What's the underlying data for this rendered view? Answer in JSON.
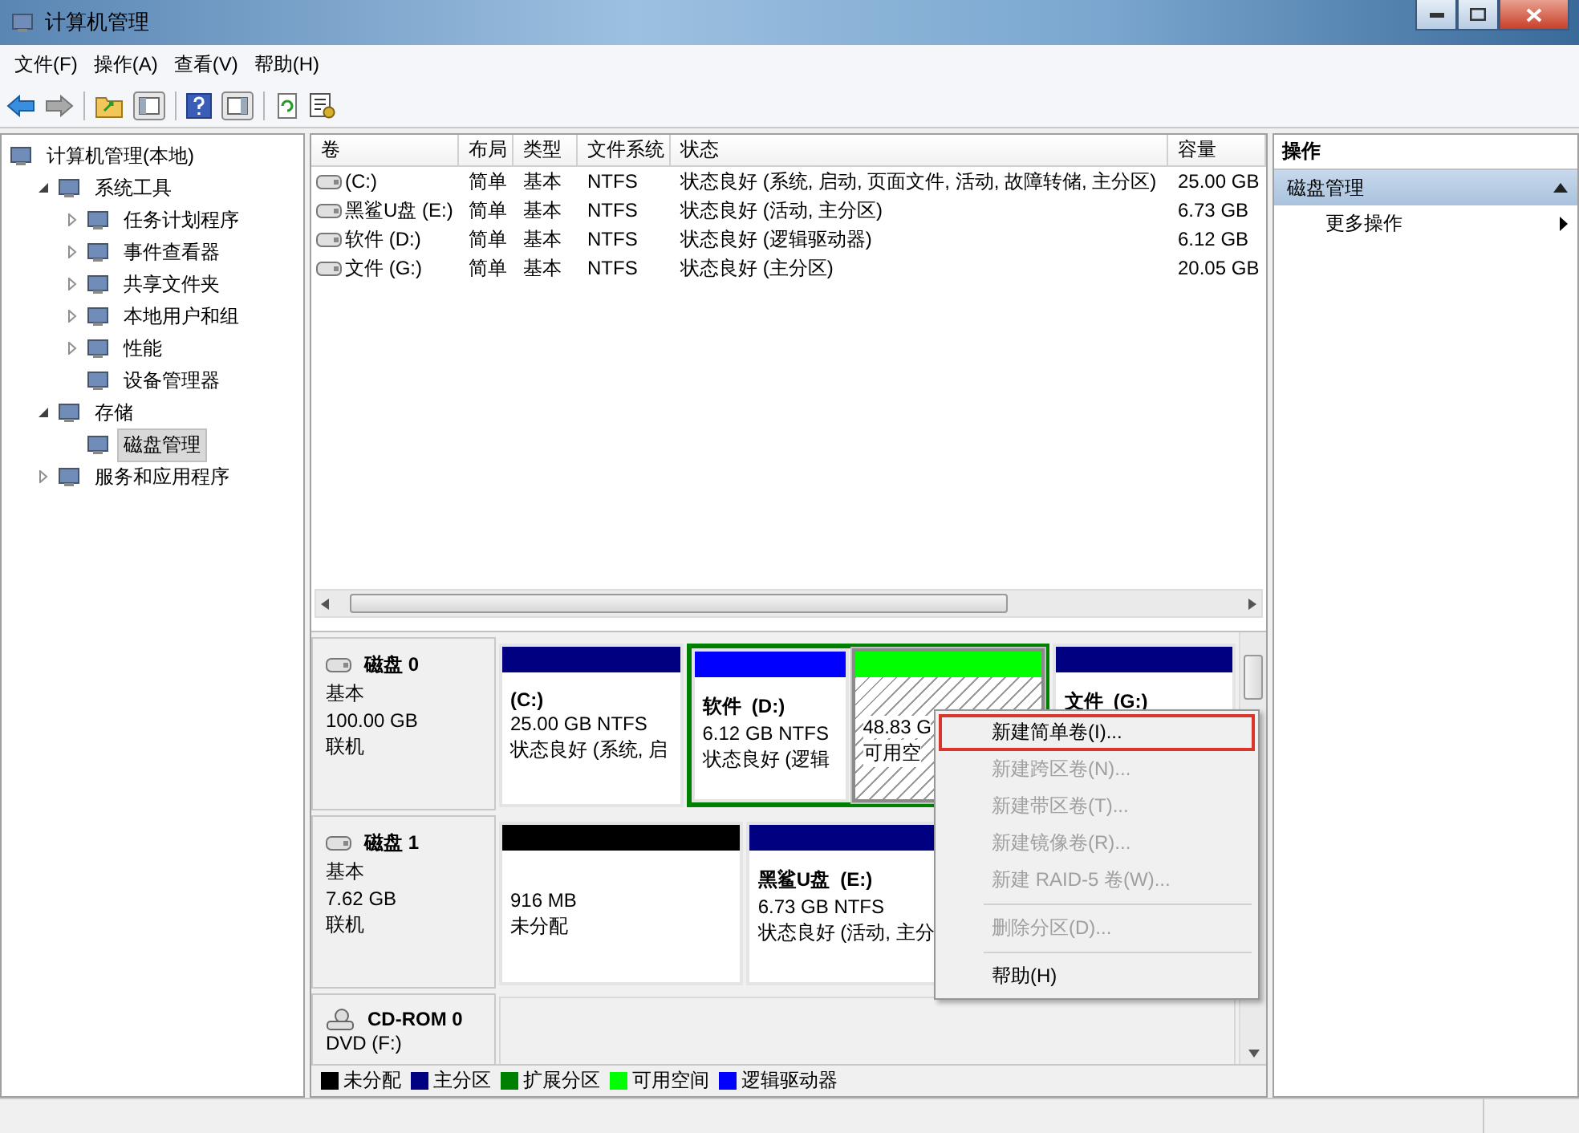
{
  "window": {
    "title": "计算机管理"
  },
  "menu": [
    "文件(F)",
    "操作(A)",
    "查看(V)",
    "帮助(H)"
  ],
  "tree": {
    "label": "计算机管理(本地)",
    "selected": false,
    "children": [
      {
        "label": "系统工具",
        "expanded": true,
        "selected": false,
        "children": [
          {
            "label": "任务计划程序",
            "expanded": false,
            "selected": false
          },
          {
            "label": "事件查看器",
            "expanded": false,
            "selected": false
          },
          {
            "label": "共享文件夹",
            "expanded": false,
            "selected": false
          },
          {
            "label": "本地用户和组",
            "expanded": false,
            "selected": false
          },
          {
            "label": "性能",
            "expanded": false,
            "selected": false
          },
          {
            "label": "设备管理器",
            "selected": false
          }
        ]
      },
      {
        "label": "存储",
        "expanded": true,
        "selected": false,
        "children": [
          {
            "label": "磁盘管理",
            "selected": true
          }
        ]
      },
      {
        "label": "服务和应用程序",
        "expanded": false,
        "selected": false
      }
    ]
  },
  "volumes": {
    "columns": [
      "卷",
      "布局",
      "类型",
      "文件系统",
      "状态",
      "容量"
    ],
    "rows": [
      [
        "(C:)",
        "简单",
        "基本",
        "NTFS",
        "状态良好 (系统, 启动, 页面文件, 活动, 故障转储, 主分区)",
        "25.00 GB"
      ],
      [
        "黑鲨U盘 (E:)",
        "简单",
        "基本",
        "NTFS",
        "状态良好 (活动, 主分区)",
        "6.73 GB"
      ],
      [
        "软件 (D:)",
        "简单",
        "基本",
        "NTFS",
        "状态良好 (逻辑驱动器)",
        "6.12 GB"
      ],
      [
        "文件 (G:)",
        "简单",
        "基本",
        "NTFS",
        "状态良好 (主分区)",
        "20.05 GB"
      ]
    ]
  },
  "disks": [
    {
      "name": "磁盘 0",
      "kind": "disk",
      "lines": [
        "基本",
        "100.00 GB",
        "联机"
      ],
      "partitions": [
        {
          "kind": "primary",
          "color": "#000080",
          "selected": false,
          "title": "(C:)",
          "lines": [
            "25.00 GB NTFS",
            "状态良好 (系统, 启"
          ]
        },
        {
          "kind": "extended",
          "color": "#008000",
          "children": [
            {
              "kind": "logical",
              "color": "#0000ff",
              "selected": false,
              "title": "软件  (D:)",
              "lines": [
                "6.12 GB NTFS",
                "状态良好 (逻辑"
              ]
            },
            {
              "kind": "free",
              "color": "#00ff00",
              "selected": true,
              "lines": [
                "48.83 G",
                "可用空"
              ]
            }
          ]
        },
        {
          "kind": "primary",
          "color": "#000080",
          "selected": false,
          "title": "文件  (G:)"
        }
      ]
    },
    {
      "name": "磁盘 1",
      "kind": "disk",
      "lines": [
        "基本",
        "7.62 GB",
        "联机"
      ],
      "partitions": [
        {
          "kind": "unallocated",
          "color": "#000000",
          "selected": false,
          "lines": [
            "916 MB",
            "未分配"
          ]
        },
        {
          "kind": "primary",
          "color": "#000080",
          "selected": false,
          "title": "黑鲨U盘  (E:)",
          "lines": [
            "6.73 GB NTFS",
            "状态良好 (活动, 主分"
          ]
        }
      ]
    },
    {
      "name": "CD-ROM 0",
      "kind": "cdrom",
      "lines": [
        "DVD (F:)"
      ]
    }
  ],
  "legend": [
    {
      "label": "未分配",
      "color": "#000000"
    },
    {
      "label": "主分区",
      "color": "#000080"
    },
    {
      "label": "扩展分区",
      "color": "#008000"
    },
    {
      "label": "可用空间",
      "color": "#00ff00"
    },
    {
      "label": "逻辑驱动器",
      "color": "#0000ff"
    }
  ],
  "context_menu": [
    [
      {
        "label": "新建简单卷(I)...",
        "disabled": false,
        "selected": true
      },
      {
        "label": "新建跨区卷(N)...",
        "disabled": true,
        "selected": false
      },
      {
        "label": "新建带区卷(T)...",
        "disabled": true,
        "selected": false
      },
      {
        "label": "新建镜像卷(R)...",
        "disabled": true,
        "selected": false
      },
      {
        "label": "新建 RAID-5 卷(W)...",
        "disabled": true,
        "selected": false
      }
    ],
    [
      {
        "label": "删除分区(D)...",
        "disabled": true,
        "selected": false
      }
    ],
    [
      {
        "label": "帮助(H)",
        "disabled": false,
        "selected": false
      }
    ]
  ],
  "actions": {
    "header": "操作",
    "section": {
      "label": "磁盘管理",
      "expanded": true
    },
    "items": [
      "更多操作"
    ]
  }
}
